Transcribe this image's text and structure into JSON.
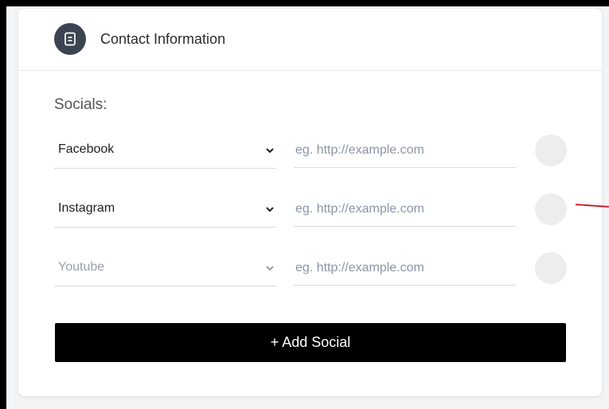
{
  "header": {
    "title": "Contact Information",
    "icon": "contact-book-icon"
  },
  "socials": {
    "label": "Socials:",
    "rows": [
      {
        "platform": "Facebook",
        "url_placeholder": "eg. http://example.com"
      },
      {
        "platform": "Instagram",
        "url_placeholder": "eg. http://example.com"
      },
      {
        "platform": "Youtube",
        "url_placeholder": "eg. http://example.com"
      }
    ],
    "add_button_label": "+ Add Social"
  },
  "colors": {
    "header_icon_bg": "#3d4451",
    "button_bg": "#000000",
    "accent_line": "#d21f2b",
    "remove_circle": "#ededed"
  }
}
